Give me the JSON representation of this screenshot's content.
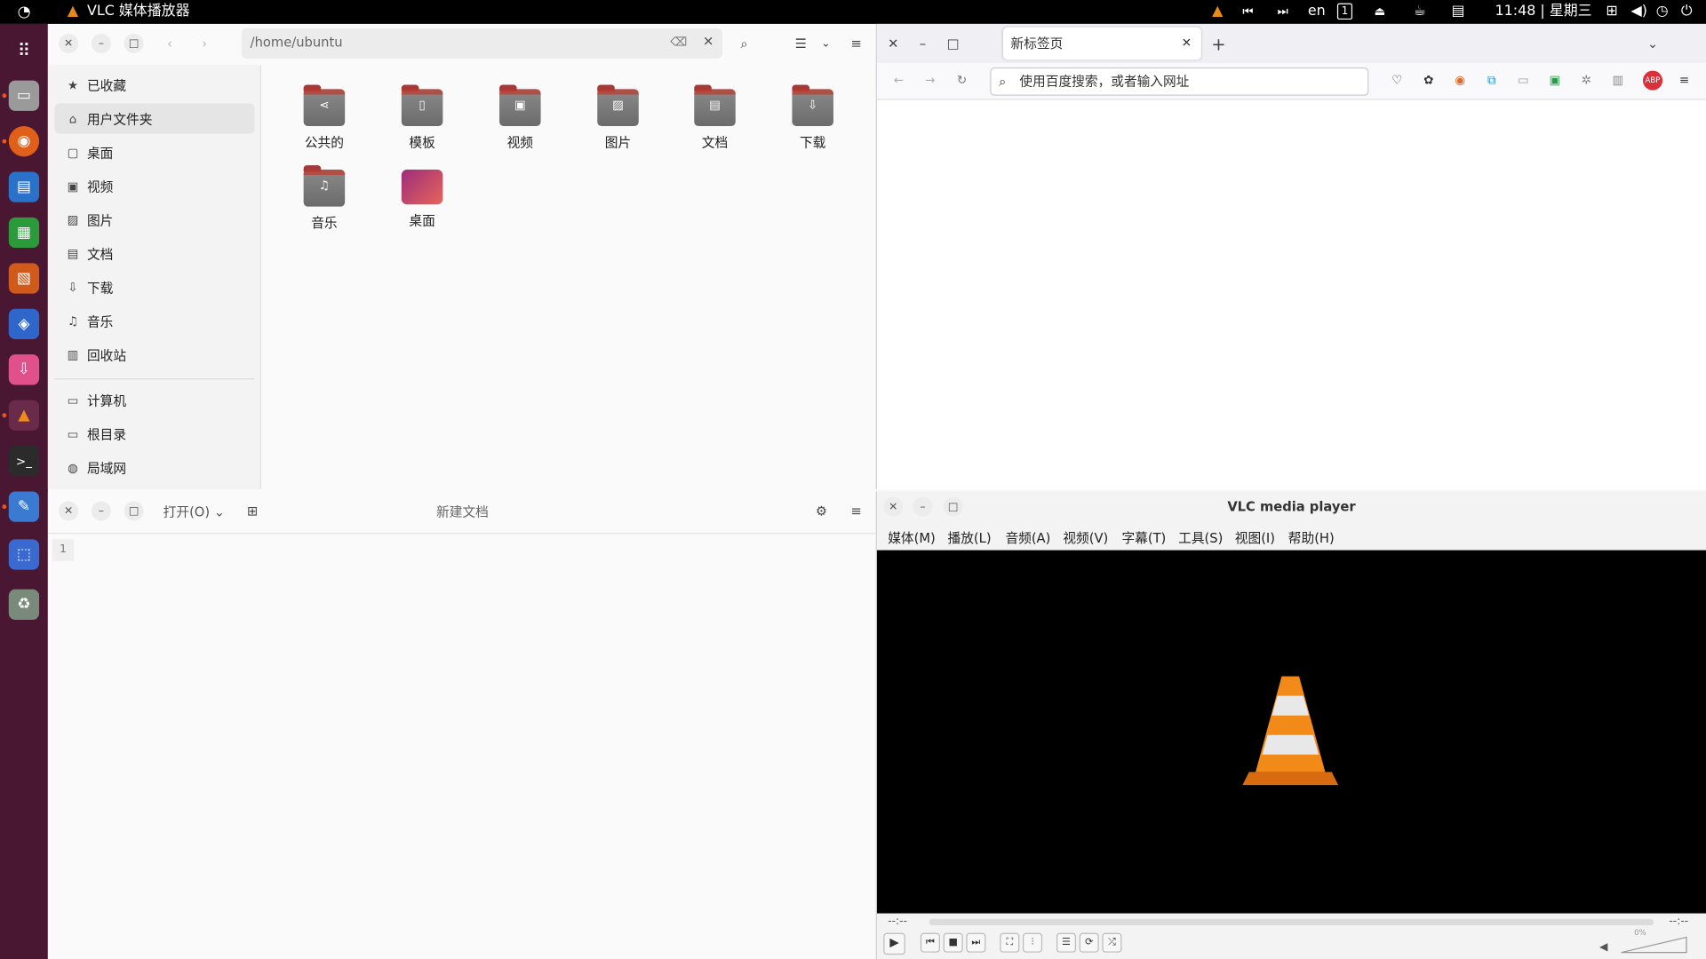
{
  "topbar": {
    "app_title": "VLC 媒体播放器",
    "lang": "en",
    "workspace": "1",
    "clock": "11:48 | 星期三"
  },
  "dock": {
    "items": [
      "show-apps",
      "files",
      "firefox",
      "writer",
      "calc",
      "impress",
      "software",
      "installer",
      "vlc",
      "terminal",
      "text-editor",
      "screenshot",
      "trash"
    ]
  },
  "files": {
    "path": "/home/ubuntu",
    "sidebar": [
      {
        "icon": "★",
        "label": "已收藏"
      },
      {
        "icon": "⌂",
        "label": "用户文件夹"
      },
      {
        "icon": "▢",
        "label": "桌面"
      },
      {
        "icon": "▣",
        "label": "视频"
      },
      {
        "icon": "▨",
        "label": "图片"
      },
      {
        "icon": "▤",
        "label": "文档"
      },
      {
        "icon": "⇩",
        "label": "下载"
      },
      {
        "icon": "♫",
        "label": "音乐"
      },
      {
        "icon": "▥",
        "label": "回收站"
      },
      {
        "icon": "▭",
        "label": "计算机"
      },
      {
        "icon": "▭",
        "label": "根目录"
      },
      {
        "icon": "◍",
        "label": "局域网"
      }
    ],
    "folders": [
      {
        "label": "公共的",
        "glyph": "⋖"
      },
      {
        "label": "模板",
        "glyph": "▯"
      },
      {
        "label": "视频",
        "glyph": "▣"
      },
      {
        "label": "图片",
        "glyph": "▨"
      },
      {
        "label": "文档",
        "glyph": "▤"
      },
      {
        "label": "下载",
        "glyph": "⇩"
      },
      {
        "label": "音乐",
        "glyph": "♫"
      },
      {
        "label": "桌面",
        "glyph": ""
      }
    ]
  },
  "firefox": {
    "tab_title": "新标签页",
    "url_placeholder": "使用百度搜索，或者输入网址",
    "abp": "ABP"
  },
  "editor": {
    "open_label": "打开(O)",
    "title": "新建文档",
    "line_number": "1"
  },
  "vlc": {
    "title": "VLC media player",
    "menu": [
      "媒体(M)",
      "播放(L)",
      "音频(A)",
      "视频(V)",
      "字幕(T)",
      "工具(S)",
      "视图(I)",
      "帮助(H)"
    ],
    "time_left": "--:--",
    "time_right": "--:--",
    "volume_text": "0%",
    "volume_level": 0.0
  }
}
